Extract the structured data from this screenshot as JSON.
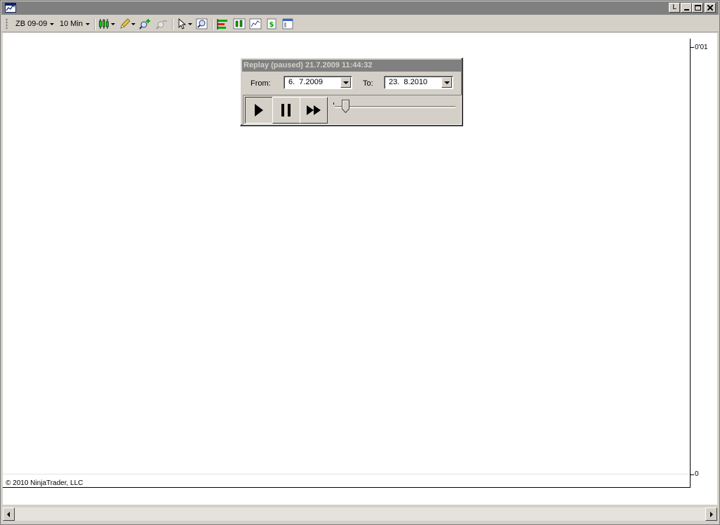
{
  "window": {
    "app_icon": "chart-icon",
    "controls": {
      "extra_label": "L",
      "minimize_icon": "minimize-icon",
      "maximize_icon": "maximize-icon",
      "close_icon": "close-icon"
    }
  },
  "toolbar": {
    "instrument": "ZB 09-09",
    "interval": "10 Min",
    "icons": [
      "candlestick-icon",
      "pencil-icon",
      "zoom-in-icon",
      "zoom-out-icon",
      "pointer-icon",
      "search-icon",
      "indicators-icon",
      "strategies-icon",
      "chart-properties-icon",
      "dollar-icon",
      "data-box-icon"
    ]
  },
  "chart": {
    "y_axis": {
      "top_label": "0'01",
      "bottom_label": "0"
    },
    "copyright": "© 2010 NinjaTrader, LLC"
  },
  "replay": {
    "title": "Replay (paused) 21.7.2009 11:44:32",
    "from_label": "From:",
    "from_value": "6.  7.2009",
    "to_label": "To:",
    "to_value": "23.  8.2010",
    "buttons": {
      "play_icon": "play-icon",
      "pause_icon": "pause-icon",
      "fast_forward_icon": "fast-forward-icon"
    },
    "progress_fraction": 0.06
  },
  "colors": {
    "title_bar": "#808080",
    "face": "#d4d0c8",
    "chart_bg": "#ffffff"
  }
}
